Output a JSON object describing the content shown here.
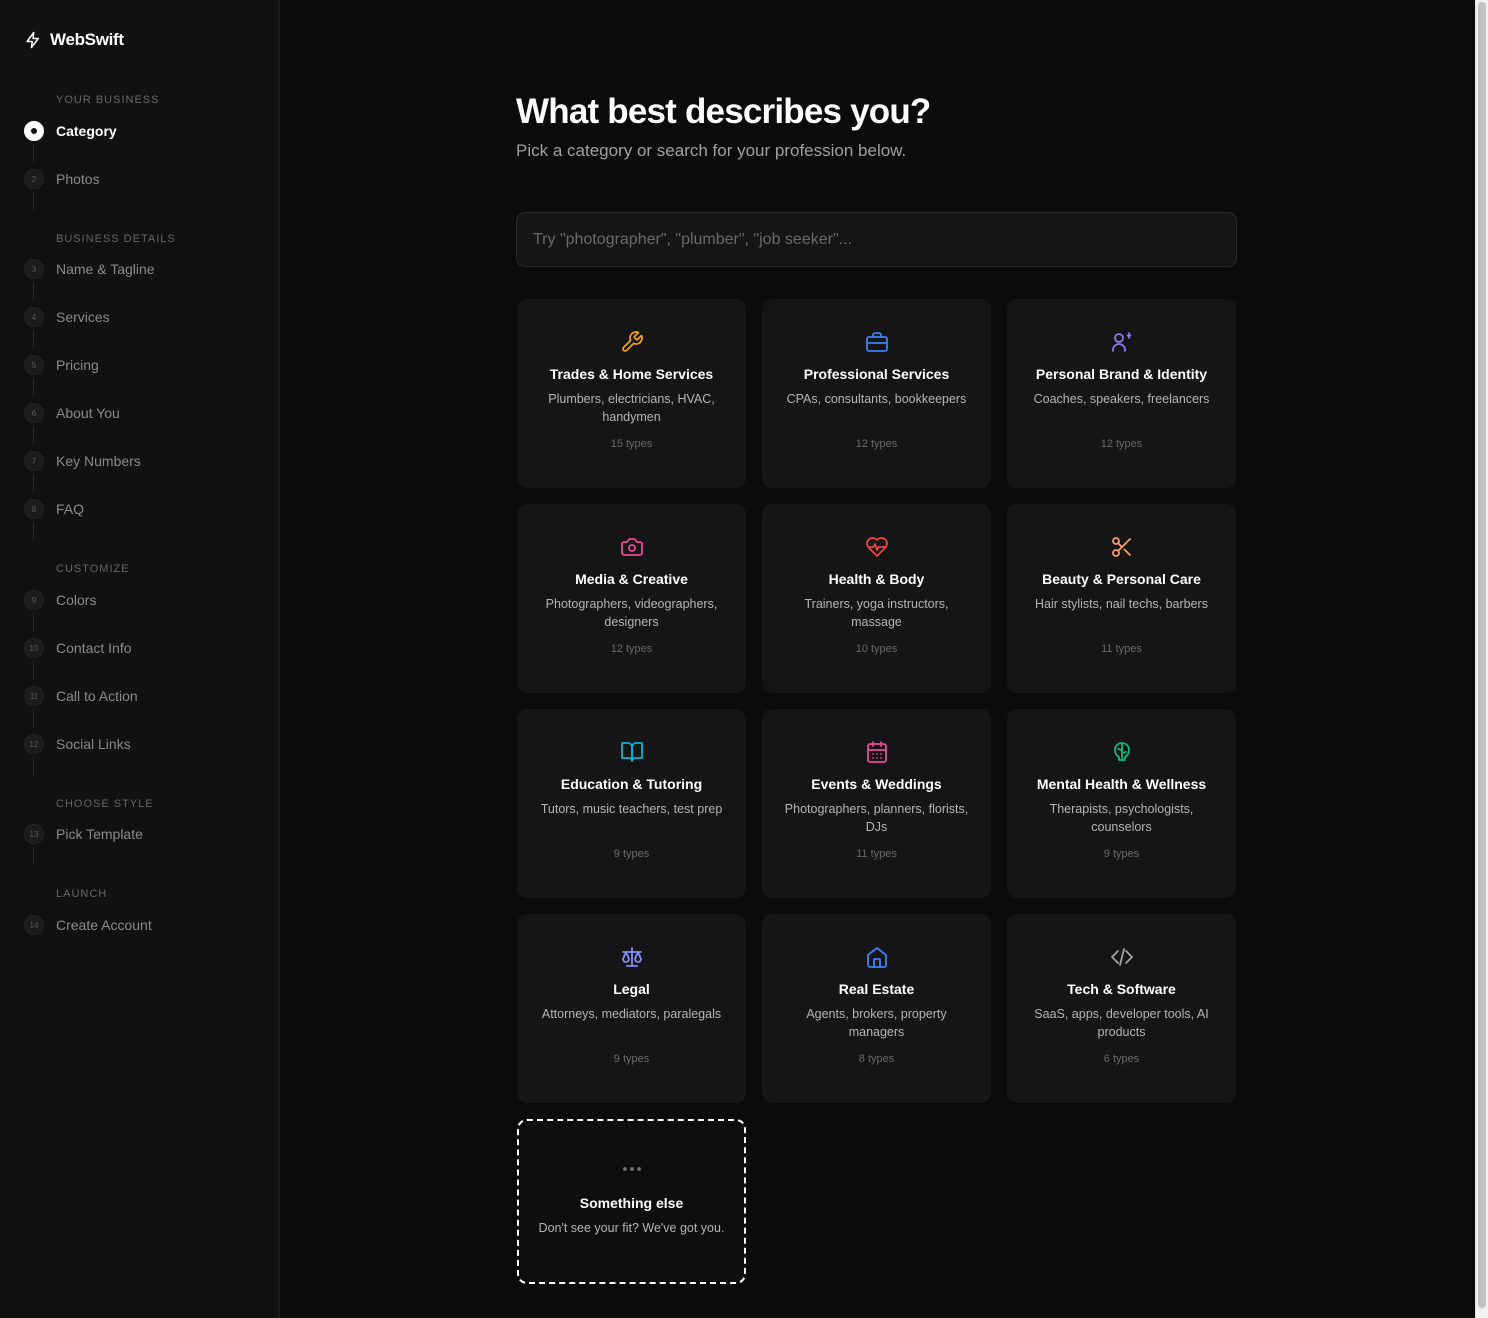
{
  "app": {
    "name": "WebSwift"
  },
  "sidebar": {
    "sections": [
      {
        "label": "YOUR BUSINESS"
      },
      {
        "label": "BUSINESS DETAILS"
      },
      {
        "label": "CUSTOMIZE"
      },
      {
        "label": "CHOOSE STYLE"
      },
      {
        "label": "LAUNCH"
      }
    ],
    "steps": [
      {
        "num": "",
        "label": "Category",
        "active": true
      },
      {
        "num": "2",
        "label": "Photos"
      },
      {
        "num": "3",
        "label": "Name & Tagline"
      },
      {
        "num": "4",
        "label": "Services"
      },
      {
        "num": "5",
        "label": "Pricing"
      },
      {
        "num": "6",
        "label": "About You"
      },
      {
        "num": "7",
        "label": "Key Numbers"
      },
      {
        "num": "8",
        "label": "FAQ"
      },
      {
        "num": "9",
        "label": "Colors"
      },
      {
        "num": "10",
        "label": "Contact Info"
      },
      {
        "num": "11",
        "label": "Call to Action"
      },
      {
        "num": "12",
        "label": "Social Links"
      },
      {
        "num": "13",
        "label": "Pick Template"
      },
      {
        "num": "14",
        "label": "Create Account"
      }
    ]
  },
  "main": {
    "title": "What best describes you?",
    "subtitle": "Pick a category or search for your profession below.",
    "search_placeholder": "Try \"photographer\", \"plumber\", \"job seeker\"...",
    "categories": [
      {
        "name": "Trades & Home Services",
        "desc": "Plumbers, electricians, HVAC, handymen",
        "count": "15 types",
        "icon": "wrench-icon",
        "color": "#f59e0b"
      },
      {
        "name": "Professional Services",
        "desc": "CPAs, consultants, bookkeepers",
        "count": "12 types",
        "icon": "briefcase-icon",
        "color": "#3b82f6"
      },
      {
        "name": "Personal Brand & Identity",
        "desc": "Coaches, speakers, freelancers",
        "count": "12 types",
        "icon": "user-star-icon",
        "color": "#8b7cf6"
      },
      {
        "name": "Media & Creative",
        "desc": "Photographers, videographers, designers",
        "count": "12 types",
        "icon": "camera-icon",
        "color": "#ec4899"
      },
      {
        "name": "Health & Body",
        "desc": "Trainers, yoga instructors, massage",
        "count": "10 types",
        "icon": "heart-pulse-icon",
        "color": "#ef4444"
      },
      {
        "name": "Beauty & Personal Care",
        "desc": "Hair stylists, nail techs, barbers",
        "count": "11 types",
        "icon": "scissors-icon",
        "color": "#f59e6b"
      },
      {
        "name": "Education & Tutoring",
        "desc": "Tutors, music teachers, test prep",
        "count": "9 types",
        "icon": "book-open-icon",
        "color": "#06b6d4"
      },
      {
        "name": "Events & Weddings",
        "desc": "Photographers, planners, florists, DJs",
        "count": "11 types",
        "icon": "calendar-icon",
        "color": "#ec4899"
      },
      {
        "name": "Mental Health & Wellness",
        "desc": "Therapists, psychologists, counselors",
        "count": "9 types",
        "icon": "brain-icon",
        "color": "#10b981"
      },
      {
        "name": "Legal",
        "desc": "Attorneys, mediators, paralegals",
        "count": "9 types",
        "icon": "scale-icon",
        "color": "#818cf8"
      },
      {
        "name": "Real Estate",
        "desc": "Agents, brokers, property managers",
        "count": "8 types",
        "icon": "house-icon",
        "color": "#3b82f6"
      },
      {
        "name": "Tech & Software",
        "desc": "SaaS, apps, developer tools, AI products",
        "count": "6 types",
        "icon": "code-icon",
        "color": "#a3a3a3"
      }
    ],
    "something_else": {
      "name": "Something else",
      "desc": "Don't see your fit? We've got you.",
      "icon": "ellipsis-icon",
      "color": "#777777"
    }
  }
}
